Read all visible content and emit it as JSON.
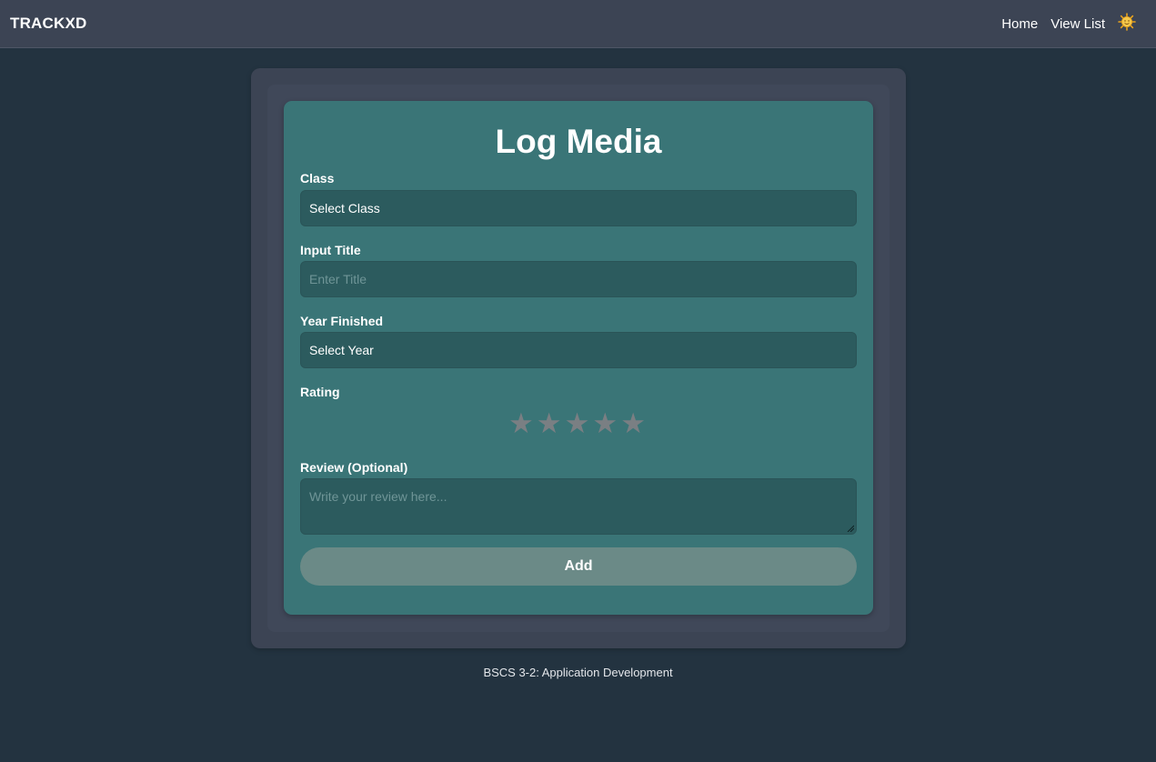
{
  "navbar": {
    "brand": "TRACKXD",
    "links": [
      "Home",
      "View List"
    ],
    "theme_icon": "sun-face-icon"
  },
  "form": {
    "title": "Log Media",
    "class_label": "Class",
    "class_value": "Select Class",
    "title_label": "Input Title",
    "title_placeholder": "Enter Title",
    "year_label": "Year Finished",
    "year_value": "Select Year",
    "rating_label": "Rating",
    "rating_value": 0,
    "rating_max": 5,
    "review_label": "Review (Optional)",
    "review_placeholder": "Write your review here...",
    "submit_label": "Add"
  },
  "footer": {
    "text": "BSCS 3-2: Application Development"
  },
  "colors": {
    "background": "#233340",
    "navbar": "#3c4454",
    "card": "#3a7577",
    "field": "#2c5b5e",
    "button": "#6b8a87",
    "star_inactive": "#7a7f83"
  }
}
